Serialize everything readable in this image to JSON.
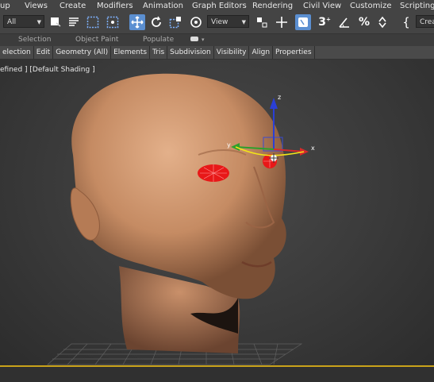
{
  "menu": [
    "up",
    "Views",
    "Create",
    "Modifiers",
    "Animation",
    "Graph Editors",
    "Rendering",
    "Civil View",
    "Customize",
    "Scripting"
  ],
  "toolbar": {
    "selection_filter": "All",
    "ref_coord": "View",
    "named_sel": "Crea"
  },
  "ribbon": {
    "selection": "Selection",
    "object_paint": "Object Paint",
    "populate": "Populate"
  },
  "tabs": [
    "election",
    "Edit",
    "Geometry (All)",
    "Elements",
    "Tris",
    "Subdivision",
    "Visibility",
    "Align",
    "Properties"
  ],
  "viewport": {
    "label": "efined ] [Default Shading ]",
    "gizmo": {
      "x_label": "x",
      "y_label": "y",
      "z_label": "z"
    }
  },
  "colors": {
    "accent": "#5b8fd1",
    "viewport_border": "#c9a21a",
    "selection_red": "#e81818"
  }
}
